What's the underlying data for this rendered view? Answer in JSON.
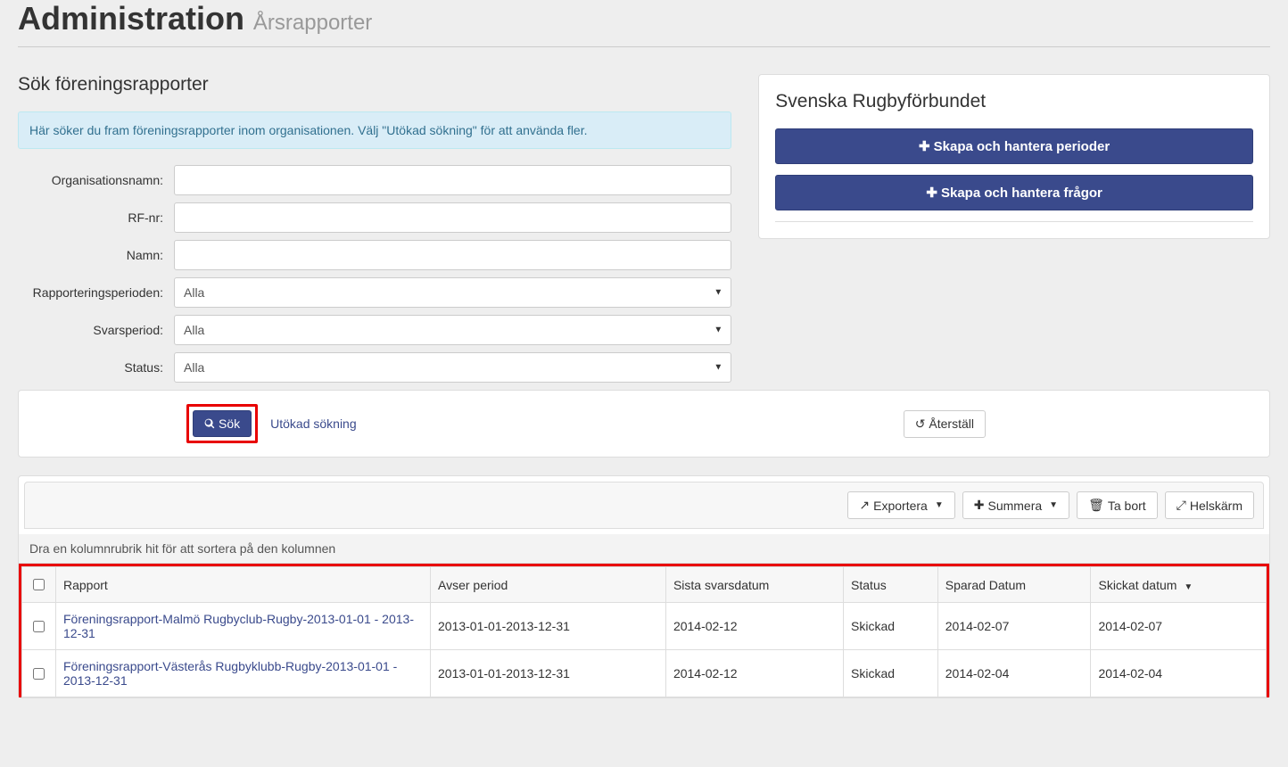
{
  "header": {
    "title": "Administration",
    "subtitle": "Årsrapporter"
  },
  "searchPanel": {
    "title": "Sök föreningsrapporter",
    "info": "Här söker du fram föreningsrapporter inom organisationen. Välj \"Utökad sökning\" för att använda fler.",
    "labels": {
      "org": "Organisationsnamn:",
      "rfnr": "RF-nr:",
      "name": "Namn:",
      "period": "Rapporteringsperioden:",
      "svar": "Svarsperiod:",
      "status": "Status:"
    },
    "selects": {
      "period": "Alla",
      "svar": "Alla",
      "status": "Alla"
    }
  },
  "actions": {
    "search": "Sök",
    "extended": "Utökad sökning",
    "reset": "Återställ"
  },
  "sidebar": {
    "title": "Svenska Rugbyförbundet",
    "btnPeriods": "Skapa och hantera perioder",
    "btnQuestions": "Skapa och hantera frågor"
  },
  "toolbar": {
    "export": "Exportera",
    "sum": "Summera",
    "delete": "Ta bort",
    "fullscreen": "Helskärm"
  },
  "grid": {
    "groupHint": "Dra en kolumnrubrik hit för att sortera på den kolumnen",
    "headers": {
      "report": "Rapport",
      "period": "Avser period",
      "deadline": "Sista svarsdatum",
      "status": "Status",
      "saved": "Sparad Datum",
      "sent": "Skickat datum"
    },
    "rows": [
      {
        "report": "Föreningsrapport-Malmö Rugbyclub-Rugby-2013-01-01 - 2013-12-31",
        "period": "2013-01-01-2013-12-31",
        "deadline": "2014-02-12",
        "status": "Skickad",
        "saved": "2014-02-07",
        "sent": "2014-02-07"
      },
      {
        "report": "Föreningsrapport-Västerås Rugbyklubb-Rugby-2013-01-01 - 2013-12-31",
        "period": "2013-01-01-2013-12-31",
        "deadline": "2014-02-12",
        "status": "Skickad",
        "saved": "2014-02-04",
        "sent": "2014-02-04"
      }
    ]
  }
}
